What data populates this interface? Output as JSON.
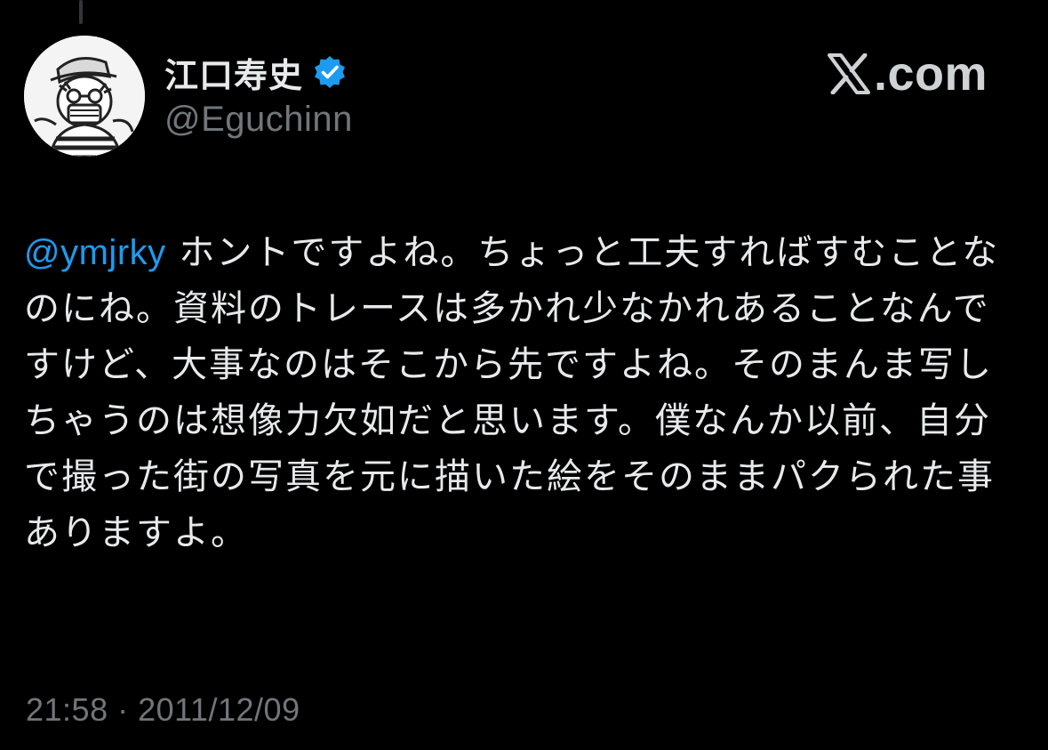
{
  "tweet": {
    "author": {
      "display_name": "江口寿史",
      "handle": "@Eguchinn",
      "verified": true
    },
    "brand": {
      "text": ".com",
      "logo_icon": "x-logo-icon"
    },
    "mention": "@ymjrky",
    "body": " ホントですよね。ちょっと工夫すればすむことなのにね。資料のトレースは多かれ少なかれあることなんですけど、大事なのはそこから先ですよね。そのまんま写しちゃうのは想像力欠如だと思います。僕なんか以前、自分で撮った街の写真を元に描いた絵をそのままパクられた事ありますよ。",
    "timestamp": "21:58 · 2011/12/09"
  },
  "colors": {
    "background": "#000000",
    "text": "#e7e9ea",
    "secondary_text": "#71767b",
    "mention": "#1d9bf0",
    "verified_badge": "#1d9bf0"
  }
}
